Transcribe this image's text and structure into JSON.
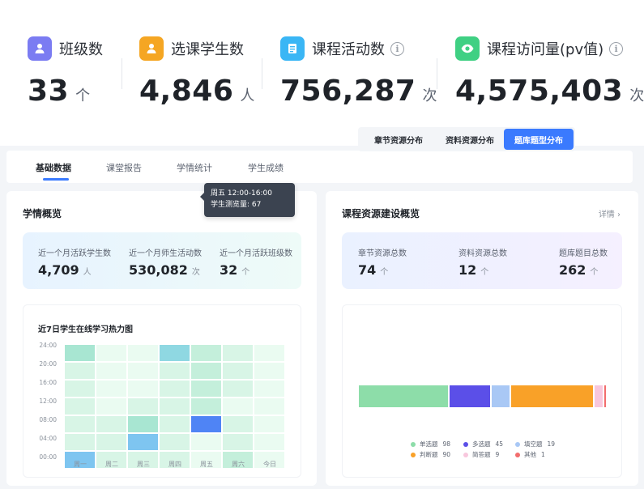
{
  "stats": [
    {
      "label": "班级数",
      "value": "33",
      "unit": "个",
      "icon": "class-icon",
      "color": "#7b7cf2"
    },
    {
      "label": "选课学生数",
      "value": "4,846",
      "unit": "人",
      "icon": "student-icon",
      "color": "#f5a623"
    },
    {
      "label": "课程活动数",
      "value": "756,287",
      "unit": "次",
      "icon": "activity-icon",
      "color": "#3ab6f5"
    },
    {
      "label": "课程访问量(pv值)",
      "value": "4,575,403",
      "unit": "次",
      "icon": "eye-icon",
      "color": "#3fd083"
    }
  ],
  "tabs": [
    "基础数据",
    "课堂报告",
    "学情统计",
    "学生成绩"
  ],
  "left": {
    "title": "学情概览",
    "summary": [
      {
        "label": "近一个月活跃学生数",
        "value": "4,709",
        "unit": "人"
      },
      {
        "label": "近一个月师生活动数",
        "value": "530,082",
        "unit": "次"
      },
      {
        "label": "近一个月活跃班级数",
        "value": "32",
        "unit": "个"
      }
    ],
    "heatmap_title": "近7日学生在线学习热力图",
    "tooltip": {
      "title": "周五 12:00-16:00",
      "line": "学生测览量: 67"
    }
  },
  "right": {
    "title": "课程资源建设概览",
    "detail": "详情 ›",
    "summary": [
      {
        "label": "章节资源总数",
        "value": "74",
        "unit": "个"
      },
      {
        "label": "资料资源总数",
        "value": "12",
        "unit": "个"
      },
      {
        "label": "题库题目总数",
        "value": "262",
        "unit": "个"
      }
    ],
    "segments": [
      "章节资源分布",
      "资料资源分布",
      "题库题型分布"
    ],
    "active_segment": 2
  },
  "chart_data": [
    {
      "type": "heatmap",
      "title": "近7日学生在线学习热力图",
      "x": [
        "周一",
        "周二",
        "周三",
        "周四",
        "周五",
        "周六",
        "今日"
      ],
      "y": [
        "00:00",
        "04:00",
        "08:00",
        "12:00",
        "16:00",
        "20:00",
        "24:00"
      ],
      "color_scale": [
        "#eafbf1",
        "#d8f5e6",
        "#c4efdb",
        "#a8e6d2",
        "#8fd8e2",
        "#7ec5f0",
        "#4f84f5"
      ],
      "values": [
        [
          3,
          0,
          0,
          4,
          2,
          1,
          0
        ],
        [
          1,
          0,
          0,
          1,
          2,
          1,
          0
        ],
        [
          1,
          0,
          0,
          1,
          2,
          1,
          0
        ],
        [
          1,
          0,
          1,
          1,
          2,
          0,
          0
        ],
        [
          1,
          1,
          3,
          1,
          6,
          1,
          0
        ],
        [
          1,
          1,
          5,
          1,
          0,
          1,
          0
        ],
        [
          5,
          1,
          1,
          1,
          0,
          2,
          0
        ]
      ],
      "highlight": {
        "x": "周五",
        "y": "12:00-16:00",
        "value": 67
      }
    },
    {
      "type": "bar",
      "stacked": true,
      "orientation": "horizontal",
      "series": [
        {
          "name": "单选题",
          "value": 98,
          "color": "#8ddda9"
        },
        {
          "name": "多选题",
          "value": 45,
          "color": "#5b4fe8"
        },
        {
          "name": "填空题",
          "value": 19,
          "color": "#a9c8f5"
        },
        {
          "name": "判断题",
          "value": 90,
          "color": "#f9a128"
        },
        {
          "name": "简答题",
          "value": 9,
          "color": "#f8c7dd"
        },
        {
          "name": "其他",
          "value": 1,
          "color": "#f26d6d"
        }
      ]
    }
  ]
}
